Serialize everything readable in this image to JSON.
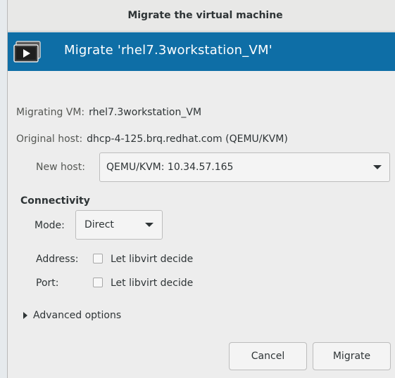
{
  "window": {
    "title": "Migrate the virtual machine"
  },
  "banner": {
    "title": "Migrate 'rhel7.3workstation_VM'",
    "icon": "vm-console-icon"
  },
  "info": {
    "migrating_label": "Migrating VM:",
    "migrating_value": "rhel7.3workstation_VM",
    "original_label": "Original host:",
    "original_value": "dhcp-4-125.brq.redhat.com (QEMU/KVM)",
    "newhost_label": "New host:",
    "newhost_value": "QEMU/KVM: 10.34.57.165"
  },
  "connectivity": {
    "title": "Connectivity",
    "mode_label": "Mode:",
    "mode_value": "Direct",
    "address_label": "Address:",
    "address_check": "Let libvirt decide",
    "port_label": "Port:",
    "port_check": "Let libvirt decide"
  },
  "advanced": {
    "label": "Advanced options"
  },
  "buttons": {
    "cancel": "Cancel",
    "migrate": "Migrate"
  },
  "colors": {
    "banner": "#0e6ea6",
    "window_bg": "#ededed"
  }
}
